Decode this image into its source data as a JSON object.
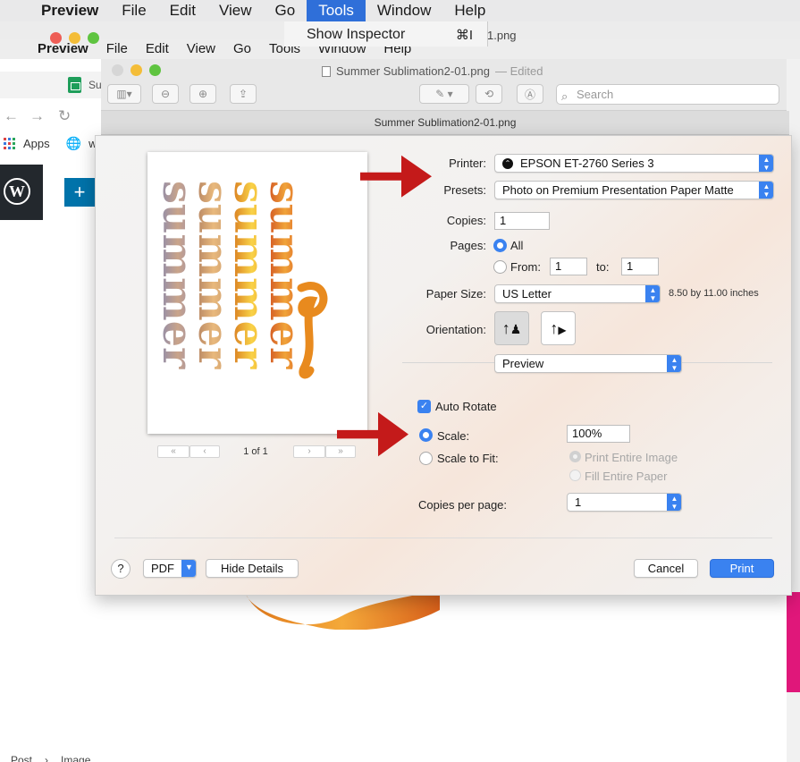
{
  "system_menubar": {
    "app": "Preview",
    "items": [
      "File",
      "Edit",
      "View",
      "Go",
      "Tools",
      "Window",
      "Help"
    ],
    "active": "Tools"
  },
  "tools_menu": {
    "item": "Show Inspector",
    "shortcut": "⌘I",
    "behind_text": "1.png"
  },
  "app_menubar": {
    "app": "Preview",
    "items": [
      "File",
      "Edit",
      "View",
      "Go",
      "Tools",
      "Window",
      "Help"
    ]
  },
  "browser": {
    "tab_label": "Su",
    "bookmarks": {
      "apps": "Apps",
      "second": "w"
    },
    "breadcrumbs": [
      "Post",
      "Image"
    ]
  },
  "preview_window": {
    "title": "Summer Sublimation2-01.png",
    "title_status": "— Edited",
    "search_placeholder": "Search",
    "document_tab": "Summer Sublimation2-01.png"
  },
  "print_dialog": {
    "printer_label": "Printer:",
    "printer": "EPSON ET-2760 Series 3",
    "presets_label": "Presets:",
    "preset": "Photo on Premium Presentation Paper Matte",
    "copies_label": "Copies:",
    "copies": "1",
    "pages_label": "Pages:",
    "pages_all": "All",
    "pages_from_label": "From:",
    "pages_from": "1",
    "pages_to_label": "to:",
    "pages_to": "1",
    "paper_size_label": "Paper Size:",
    "paper_size": "US Letter",
    "paper_dims": "8.50 by 11.00 inches",
    "orientation_label": "Orientation:",
    "section": "Preview",
    "auto_rotate": "Auto Rotate",
    "scale_label": "Scale:",
    "scale": "100%",
    "scale_to_fit": "Scale to Fit:",
    "print_entire_image": "Print Entire Image",
    "fill_entire_paper": "Fill Entire Paper",
    "copies_per_page_label": "Copies per page:",
    "copies_per_page": "1",
    "page_indicator": "1 of 1",
    "pdf": "PDF",
    "hide_details": "Hide Details",
    "cancel": "Cancel",
    "print": "Print",
    "help": "?"
  },
  "thumbnail_text": "summer",
  "colors": {
    "accent": "#3a82f0",
    "arrow": "#c41a1a",
    "menu_highlight": "#2f6fd9"
  }
}
